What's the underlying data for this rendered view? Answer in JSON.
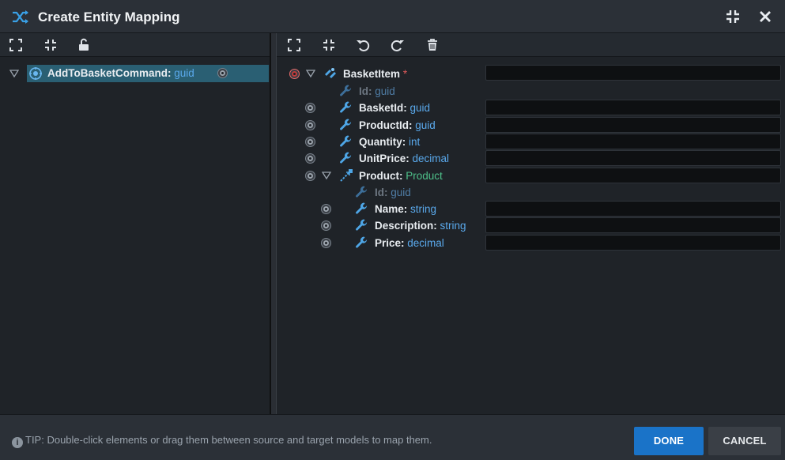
{
  "window": {
    "title": "Create Entity Mapping"
  },
  "source": {
    "root": {
      "name": "AddToBasketCommand",
      "type": "guid"
    }
  },
  "target": {
    "root": {
      "name": "BasketItem",
      "required_marker": "*"
    },
    "fields": [
      {
        "name": "Id",
        "type": "guid",
        "dim": true
      },
      {
        "name": "BasketId",
        "type": "guid"
      },
      {
        "name": "ProductId",
        "type": "guid"
      },
      {
        "name": "Quantity",
        "type": "int"
      },
      {
        "name": "UnitPrice",
        "type": "decimal"
      },
      {
        "name": "Product",
        "type": "Product",
        "association": true
      },
      {
        "name": "Id",
        "type": "guid",
        "dim": true,
        "child": true
      },
      {
        "name": "Name",
        "type": "string",
        "child": true
      },
      {
        "name": "Description",
        "type": "string",
        "child": true
      },
      {
        "name": "Price",
        "type": "decimal",
        "child": true
      }
    ]
  },
  "footer": {
    "tip": "TIP: Double-click elements or drag them between source and target models to map them.",
    "done_label": "DONE",
    "cancel_label": "CANCEL"
  },
  "colors": {
    "accent": "#1a73c8",
    "type": "#5aa9ec",
    "association_type": "#4ec08a",
    "selected_row": "#2a5f73"
  }
}
